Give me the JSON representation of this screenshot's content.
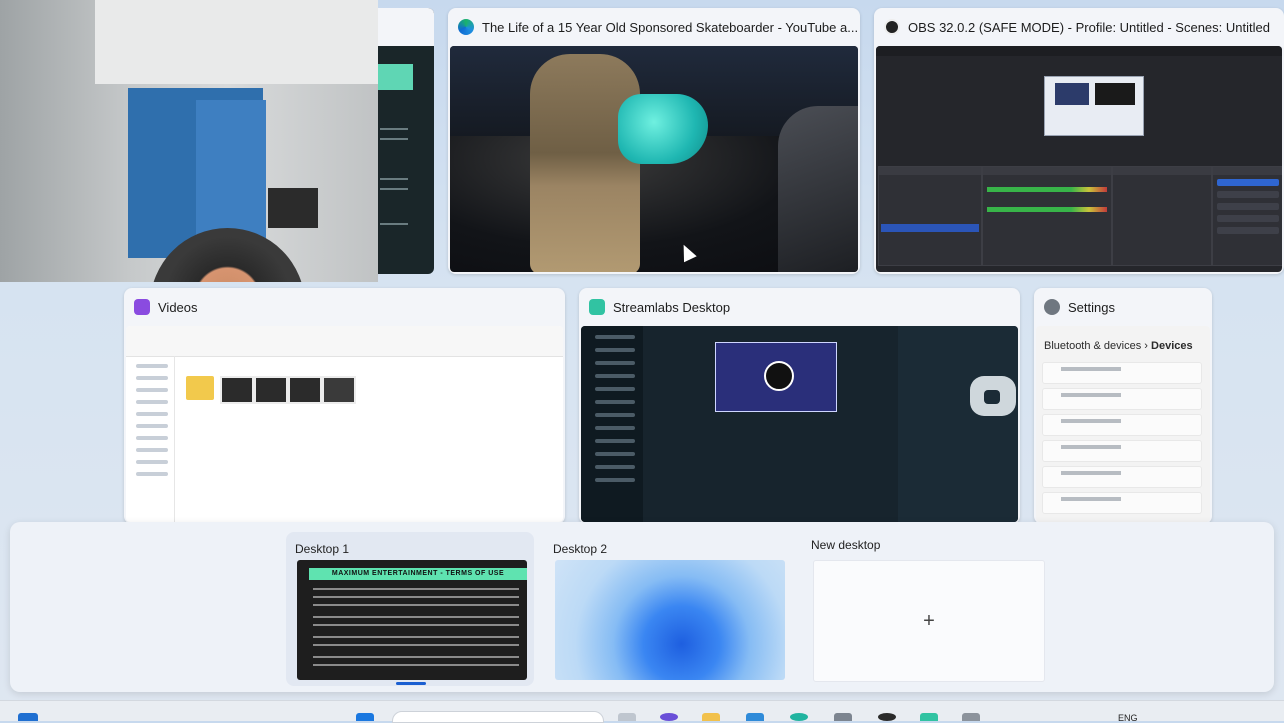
{
  "windows": {
    "youtube": {
      "title": "The Life of a 15 Year Old Sponsored Skateboarder - YouTube a...",
      "icon": "edge-icon"
    },
    "obs": {
      "title": "OBS 32.0.2 (SAFE MODE) - Profile: Untitled - Scenes: Untitled",
      "icon": "obs-icon"
    },
    "videos": {
      "title": "Videos",
      "icon": "file-explorer-icon"
    },
    "streamlabs": {
      "title": "Streamlabs Desktop",
      "icon": "streamlabs-icon"
    },
    "settings": {
      "title": "Settings",
      "icon": "gear-icon",
      "breadcrumb_parent": "Bluetooth & devices",
      "breadcrumb_sep": "›",
      "breadcrumb_current": "Devices"
    }
  },
  "desktops": {
    "desktop1": {
      "label": "Desktop 1",
      "terms_heading": "MAXIMUM ENTERTAINMENT - TERMS OF USE"
    },
    "desktop2": {
      "label": "Desktop 2"
    },
    "new": {
      "label": "New desktop",
      "plus": "+"
    }
  },
  "taskbar": {
    "lang": "ENG"
  },
  "colors": {
    "accent": "#1b5fd1",
    "streamlabs": "#31c3a2",
    "obs_dark": "#25262b"
  }
}
